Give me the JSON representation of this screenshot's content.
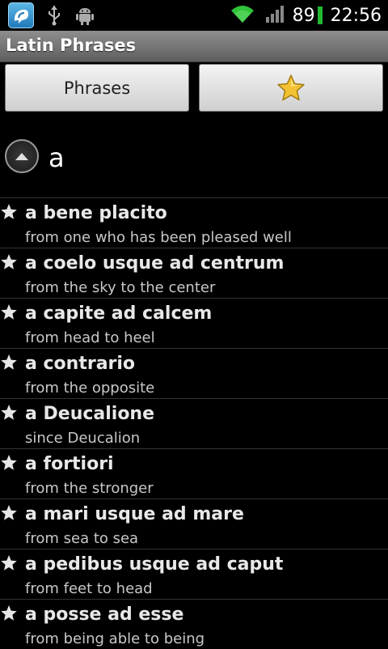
{
  "statusbar": {
    "battery": "89",
    "time": "22:56",
    "icons": [
      "app-notification-icon",
      "usb-icon",
      "android-debug-icon",
      "wifi-icon",
      "signal-icon",
      "battery-icon"
    ]
  },
  "app": {
    "title": "Latin Phrases"
  },
  "buttons": {
    "phrases_label": "Phrases",
    "favorites_icon": "star-icon"
  },
  "group": {
    "letter": "a"
  },
  "phrases": [
    {
      "latin": "a bene placito",
      "english": "from one who has been pleased well"
    },
    {
      "latin": "a coelo usque ad centrum",
      "english": "from the sky to the center"
    },
    {
      "latin": "a capite ad calcem",
      "english": "from head to heel"
    },
    {
      "latin": "a contrario",
      "english": "from the opposite"
    },
    {
      "latin": "a Deucalione",
      "english": "since Deucalion"
    },
    {
      "latin": "a fortiori",
      "english": "from the stronger"
    },
    {
      "latin": "a mari usque ad mare",
      "english": "from sea to sea"
    },
    {
      "latin": "a pedibus usque ad caput",
      "english": "from feet to head"
    },
    {
      "latin": "a posse ad esse",
      "english": "from being able to being"
    }
  ],
  "colors": {
    "favorite_star": "#f2c233",
    "battery_green": "#22b830",
    "wifi_green": "#2fc23a"
  }
}
